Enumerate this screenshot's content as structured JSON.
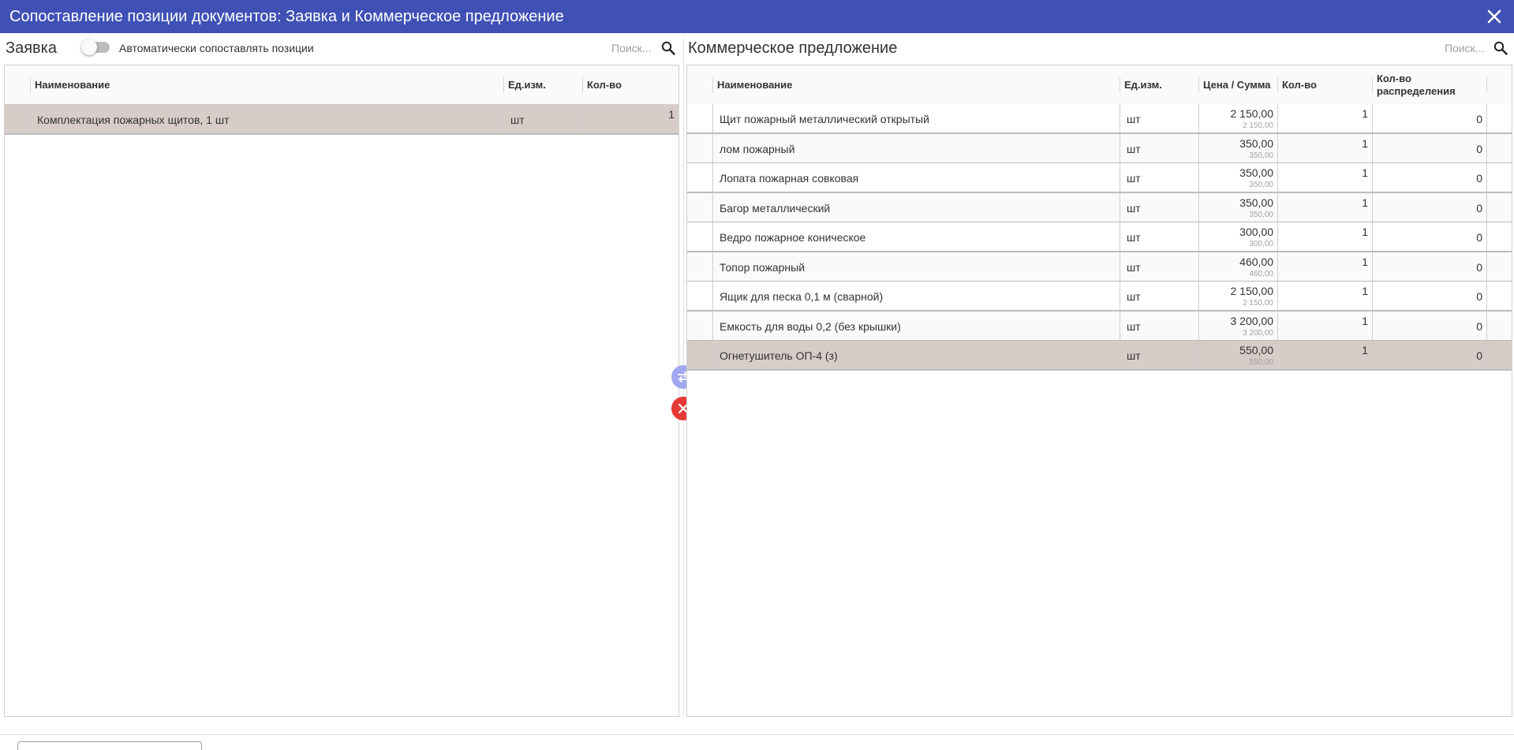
{
  "window": {
    "title": "Сопоставление позиции документов: Заявка и Коммерческое предложение"
  },
  "left_panel": {
    "title": "Заявка",
    "auto_match_label": "Автоматически сопоставлять позиции",
    "auto_match_enabled": false,
    "search_placeholder": "Поиск...",
    "columns": [
      "Наименование",
      "Ед.изм.",
      "Кол-во"
    ],
    "rows": [
      {
        "name": "Комплектация пожарных щитов, 1 шт",
        "unit": "шт",
        "qty": "1",
        "selected": true
      }
    ]
  },
  "right_panel": {
    "title": "Коммерческое предложение",
    "search_placeholder": "Поиск...",
    "columns": [
      "Наименование",
      "Ед.изм.",
      "Цена / Сумма",
      "Кол-во",
      "Кол-во распределения"
    ],
    "rows": [
      {
        "name": "Щит пожарный металлический открытый",
        "unit": "шт",
        "price": "2 150,00",
        "sum": "2 150,00",
        "qty": "1",
        "dist": "0"
      },
      {
        "name": "лом пожарный",
        "unit": "шт",
        "price": "350,00",
        "sum": "350,00",
        "qty": "1",
        "dist": "0"
      },
      {
        "name": "Лопата пожарная совковая",
        "unit": "шт",
        "price": "350,00",
        "sum": "350,00",
        "qty": "1",
        "dist": "0"
      },
      {
        "name": "Багор металлический",
        "unit": "шт",
        "price": "350,00",
        "sum": "350,00",
        "qty": "1",
        "dist": "0"
      },
      {
        "name": "Ведро пожарное коническое",
        "unit": "шт",
        "price": "300,00",
        "sum": "300,00",
        "qty": "1",
        "dist": "0"
      },
      {
        "name": "Топор пожарный",
        "unit": "шт",
        "price": "460,00",
        "sum": "460,00",
        "qty": "1",
        "dist": "0"
      },
      {
        "name": "Ящик для песка 0,1 м (сварной)",
        "unit": "шт",
        "price": "2 150,00",
        "sum": "2 150,00",
        "qty": "1",
        "dist": "0"
      },
      {
        "name": "Емкость для воды 0,2 (без крышки)",
        "unit": "шт",
        "price": "3 200,00",
        "sum": "3 200,00",
        "qty": "1",
        "dist": "0"
      },
      {
        "name": "Огнетушитель ОП-4 (з)",
        "unit": "шт",
        "price": "550,00",
        "sum": "550,00",
        "qty": "1",
        "dist": "0",
        "selected": true
      }
    ]
  },
  "actions": {
    "swap_icon": "swap-arrows-icon",
    "clear_icon": "close-icon"
  },
  "colors": {
    "header_bg": "#3f51b5",
    "selected_row": "#d7ccc8",
    "swap_button": "#9fa8f0",
    "clear_button": "#e53935"
  }
}
